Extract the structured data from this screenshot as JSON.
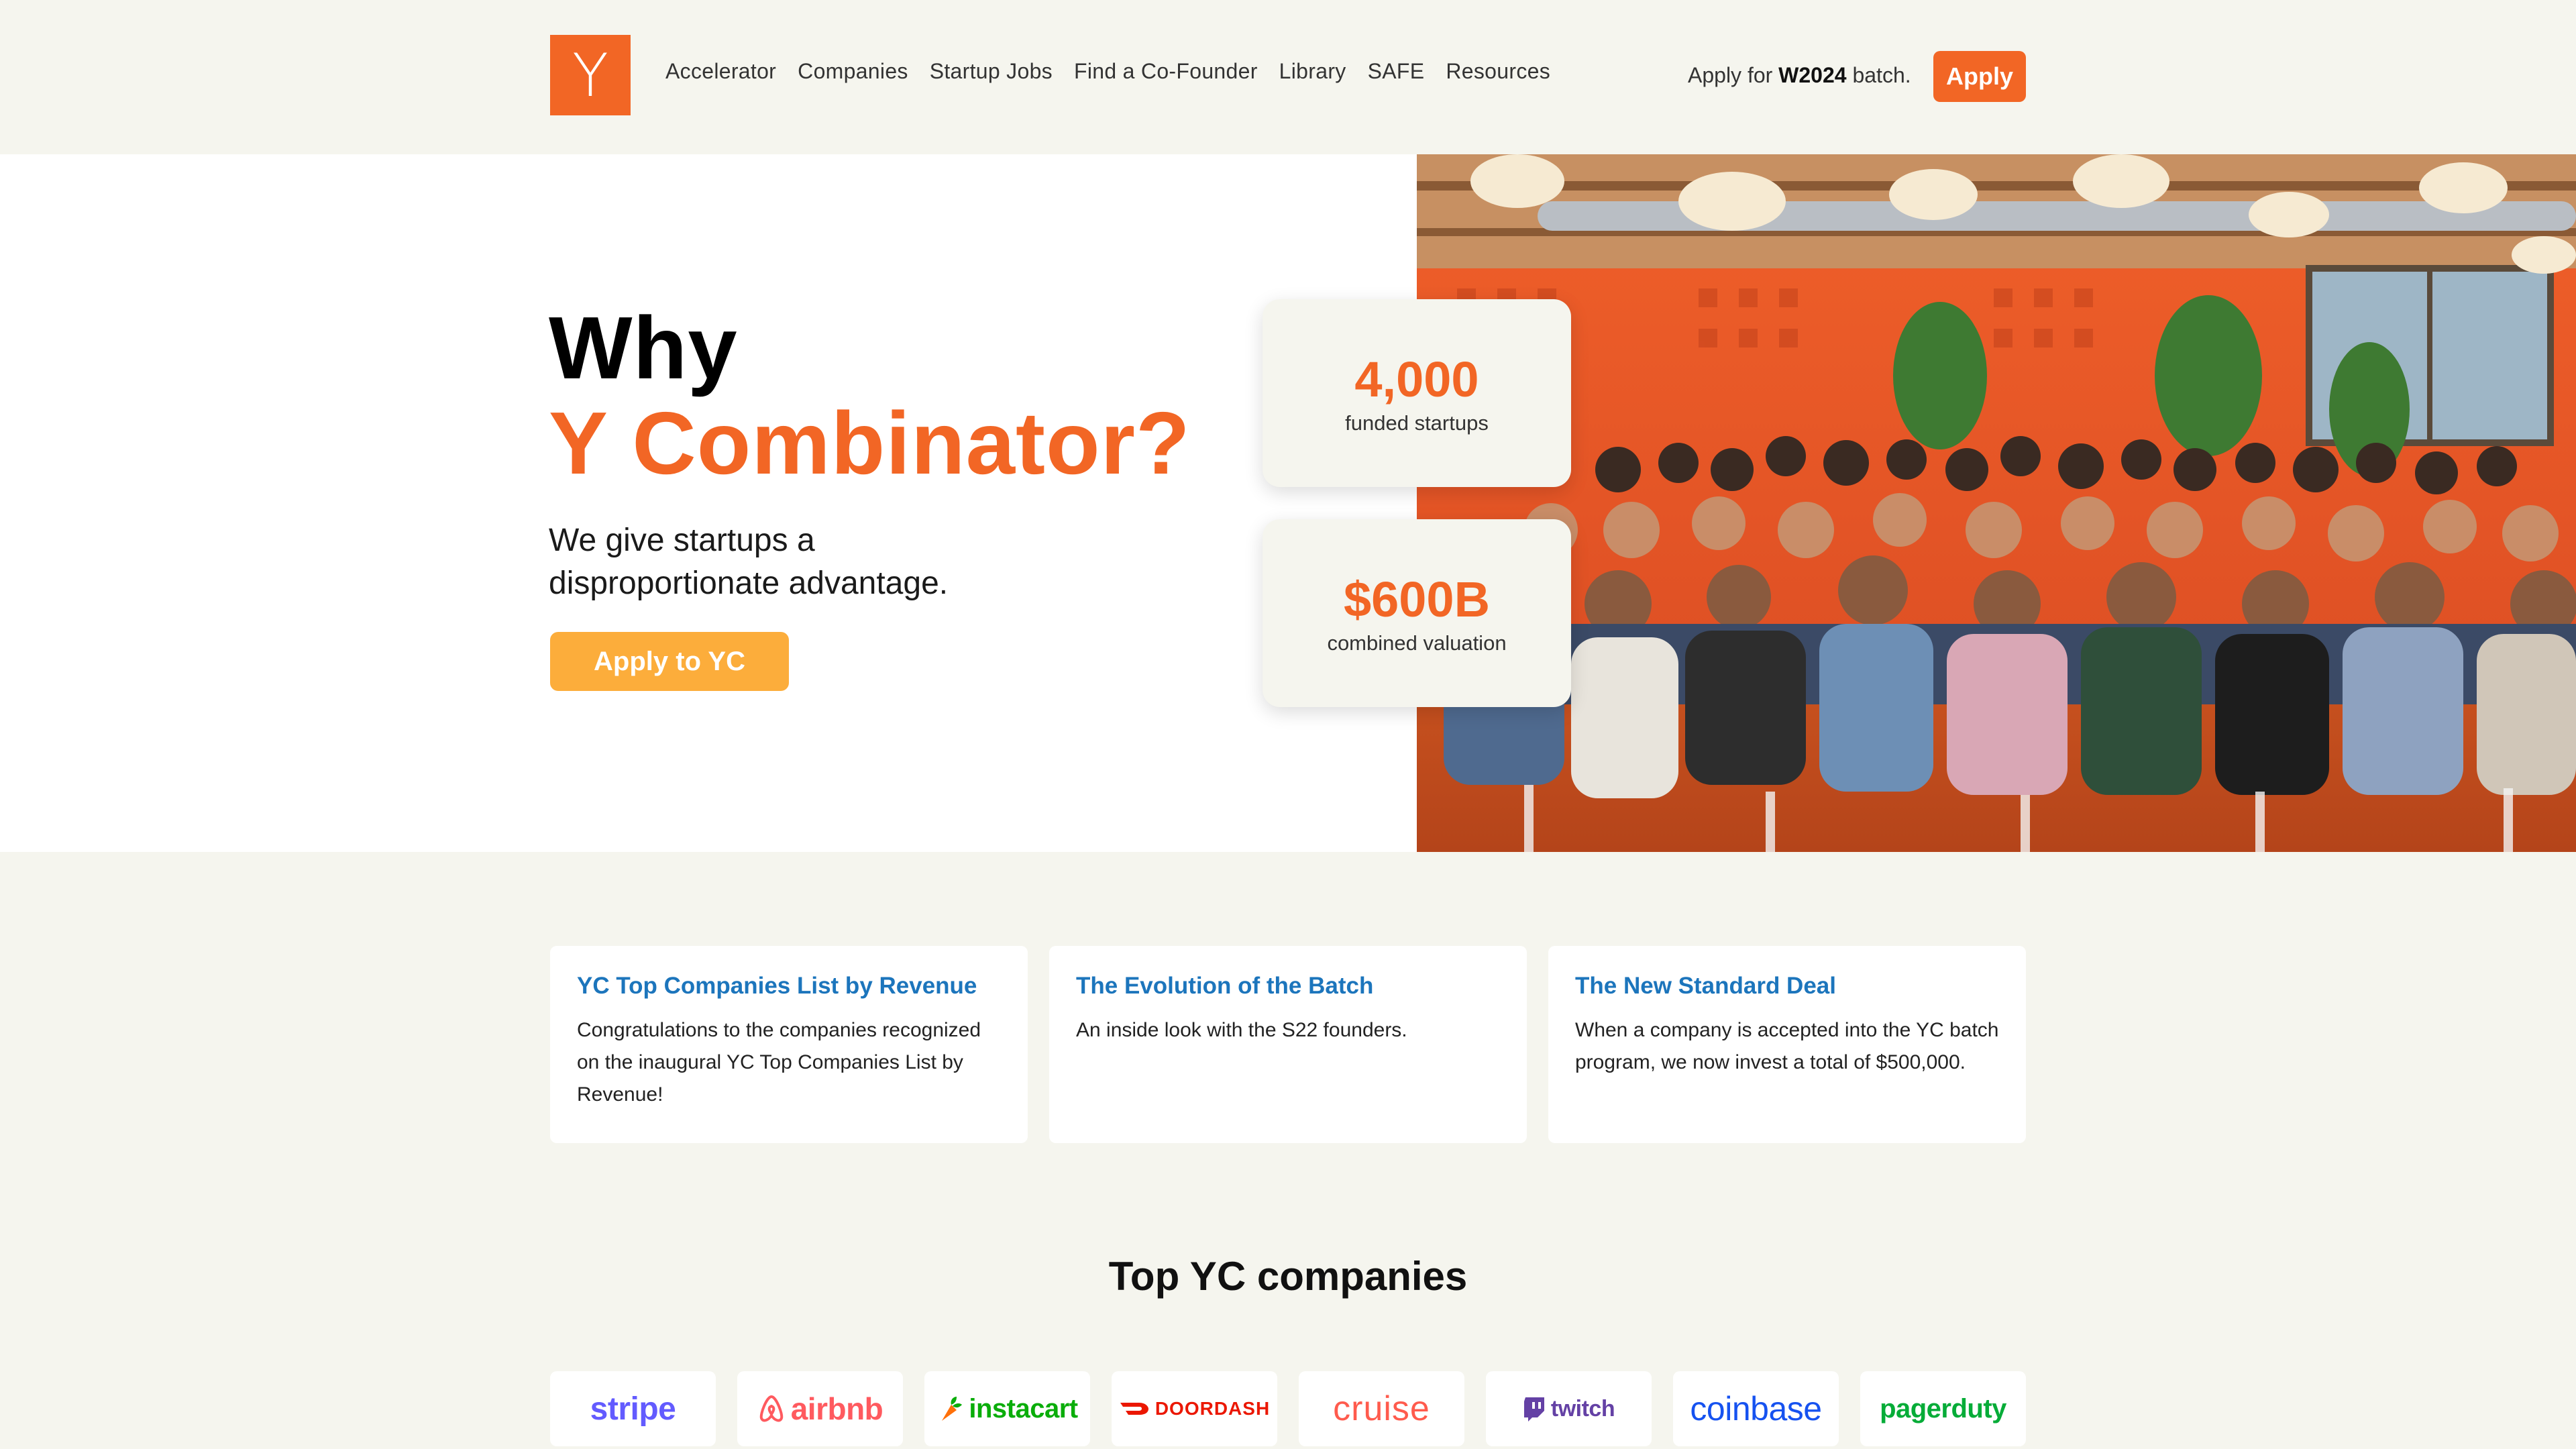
{
  "header": {
    "logo_letter": "Y",
    "nav": [
      "Accelerator",
      "Companies",
      "Startup Jobs",
      "Find a Co-Founder",
      "Library",
      "SAFE",
      "Resources"
    ],
    "apply_prefix": "Apply for",
    "apply_batch": "W2024",
    "apply_suffix": "batch.",
    "apply_button": "Apply"
  },
  "hero": {
    "title_line1": "Why",
    "title_line2": "Y Combinator?",
    "subtitle": "We give startups a disproportionate advantage.",
    "cta": "Apply to YC"
  },
  "stats": [
    {
      "value": "4,000",
      "label": "funded startups"
    },
    {
      "value": "$600B",
      "label": "combined valuation"
    }
  ],
  "cards": [
    {
      "title": "YC Top Companies List by Revenue",
      "body": "Congratulations to the companies recognized on the inaugural YC Top Companies List by Revenue!"
    },
    {
      "title": "The Evolution of the Batch",
      "body": "An inside look with the S22 founders."
    },
    {
      "title": "The New Standard Deal",
      "body": "When a company is accepted into the YC batch program, we now invest a total of $500,000."
    }
  ],
  "companies": {
    "title": "Top YC companies",
    "logos": [
      {
        "name": "stripe",
        "color": "#635bff",
        "icon": ""
      },
      {
        "name": "airbnb",
        "color": "#ff5a5f",
        "icon": "airbnb-icon"
      },
      {
        "name": "instacart",
        "color": "#0aad0a",
        "icon": "carrot-icon"
      },
      {
        "name": "DOORDASH",
        "color": "#eb1700",
        "icon": "doordash-icon"
      },
      {
        "name": "cruise",
        "color": "#ff5b4d",
        "icon": ""
      },
      {
        "name": "twitch",
        "color": "#6441a5",
        "icon": "twitch-icon"
      },
      {
        "name": "coinbase",
        "color": "#1652f0",
        "icon": ""
      },
      {
        "name": "pagerduty",
        "color": "#06ac38",
        "icon": ""
      }
    ]
  },
  "colors": {
    "brand": "#f26625",
    "cta": "#fcad3b",
    "link": "#1c75bc",
    "background": "#f5f5ee"
  }
}
